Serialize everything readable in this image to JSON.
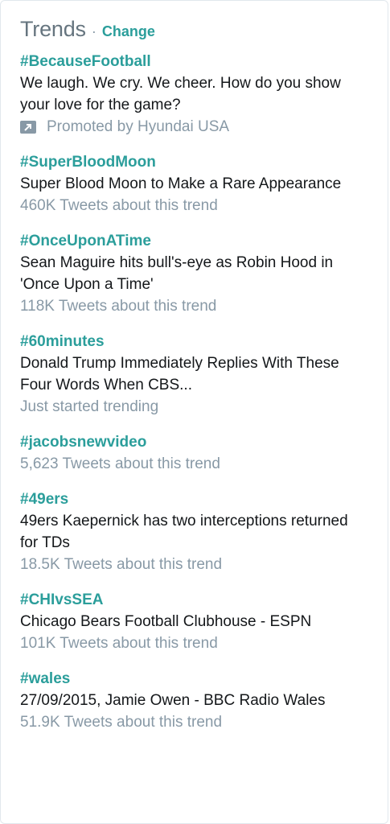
{
  "header": {
    "title": "Trends",
    "separator": "·",
    "change_label": "Change"
  },
  "trends": [
    {
      "hashtag": "#BecauseFootball",
      "description": "We laugh. We cry. We cheer. How do you show your love for the game?",
      "meta": "Promoted by Hyundai USA",
      "promoted": true,
      "icon": "promoted-arrow-icon"
    },
    {
      "hashtag": "#SuperBloodMoon",
      "description": "Super Blood Moon to Make a Rare Appearance",
      "meta": "460K Tweets about this trend"
    },
    {
      "hashtag": "#OnceUponATime",
      "description": "Sean Maguire hits bull's-eye as Robin Hood in 'Once Upon a Time'",
      "meta": "118K Tweets about this trend"
    },
    {
      "hashtag": "#60minutes",
      "description": "Donald Trump Immediately Replies With These Four Words When CBS...",
      "meta": "Just started trending"
    },
    {
      "hashtag": "#jacobsnewvideo",
      "description": "",
      "meta": "5,623 Tweets about this trend"
    },
    {
      "hashtag": "#49ers",
      "description": "49ers Kaepernick has two interceptions returned for TDs",
      "meta": "18.5K Tweets about this trend"
    },
    {
      "hashtag": "#CHIvsSEA",
      "description": "Chicago Bears Football Clubhouse - ESPN",
      "meta": "101K Tweets about this trend"
    },
    {
      "hashtag": "#wales",
      "description": "27/09/2015, Jamie Owen - BBC Radio Wales",
      "meta": "51.9K Tweets about this trend"
    }
  ],
  "colors": {
    "link": "#2b9e9b",
    "text": "#14171a",
    "muted": "#8899a6",
    "title": "#66757f"
  }
}
